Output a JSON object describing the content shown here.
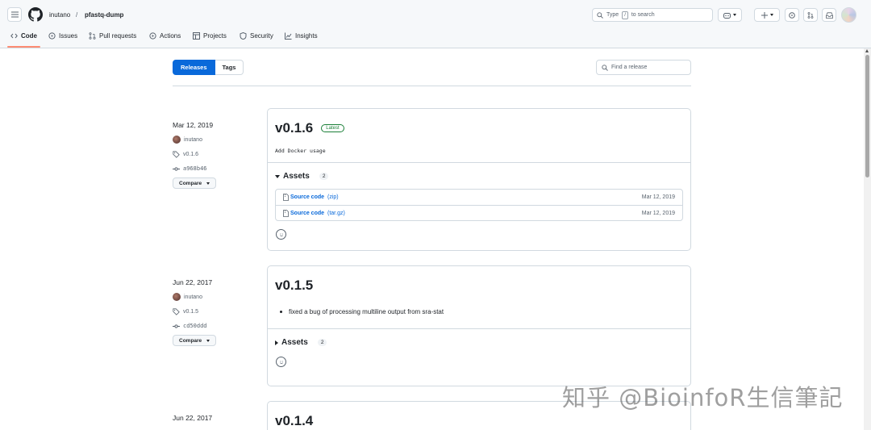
{
  "header": {
    "owner": "inutano",
    "separator": "/",
    "repo": "pfastq-dump",
    "search_placeholder_prefix": "Type",
    "search_key": "/",
    "search_placeholder_suffix": "to search"
  },
  "tabs": [
    {
      "label": "Code",
      "icon": "code-icon",
      "active": true
    },
    {
      "label": "Issues",
      "icon": "issue-icon"
    },
    {
      "label": "Pull requests",
      "icon": "pull-request-icon"
    },
    {
      "label": "Actions",
      "icon": "play-icon"
    },
    {
      "label": "Projects",
      "icon": "table-icon"
    },
    {
      "label": "Security",
      "icon": "shield-icon"
    },
    {
      "label": "Insights",
      "icon": "graph-icon"
    }
  ],
  "subnav": {
    "releases_label": "Releases",
    "tags_label": "Tags",
    "find_placeholder": "Find a release"
  },
  "compare_label": "Compare",
  "assets_label": "Assets",
  "releases": [
    {
      "date": "Mar 12, 2019",
      "author": "inutano",
      "tag": "v0.1.6",
      "commit": "a968b46",
      "name": "v0.1.6",
      "badge": "Latest",
      "body": "Add Docker usage",
      "assets_count": "2",
      "assets": [
        {
          "name": "Source code",
          "type": "(zip)",
          "date": "Mar 12, 2019"
        },
        {
          "name": "Source code",
          "type": "(tar.gz)",
          "date": "Mar 12, 2019"
        }
      ]
    },
    {
      "date": "Jun 22, 2017",
      "author": "inutano",
      "tag": "v0.1.5",
      "commit": "cd50ddd",
      "name": "v0.1.5",
      "bullet": "fixed a bug of processing multiline output from sra-stat",
      "assets_count": "2"
    },
    {
      "date": "Jun 22, 2017",
      "name": "v0.1.4"
    }
  ],
  "watermark": "知乎 @BioinfoR生信筆記",
  "colors": {
    "accent": "#0969da",
    "latest": "#1a7f37",
    "tab_underline": "#fd8c73"
  }
}
